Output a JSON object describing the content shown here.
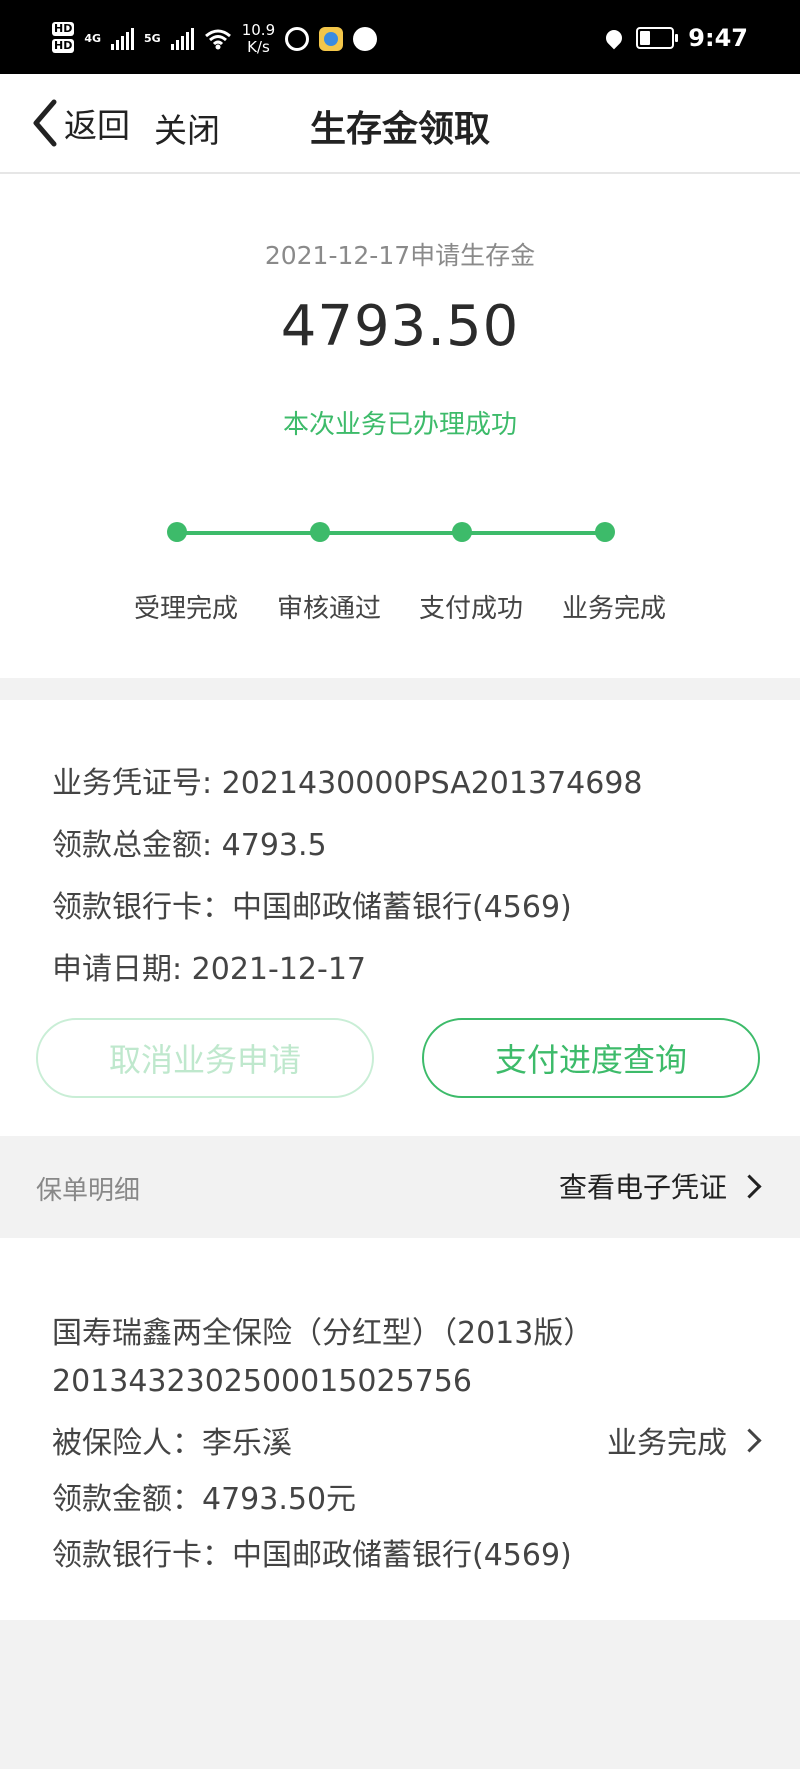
{
  "status_bar": {
    "hd1": "HD",
    "hd2": "HD",
    "net1": "4G",
    "net2": "5G",
    "speed_value": "10.9",
    "speed_unit": "K/s",
    "time": "9:47"
  },
  "nav": {
    "back_label": "返回",
    "close_label": "关闭",
    "title": "生存金领取"
  },
  "summary": {
    "apply_line": "2021-12-17申请生存金",
    "amount": "4793.50",
    "status": "本次业务已办理成功",
    "steps": [
      "受理完成",
      "审核通过",
      "支付成功",
      "业务完成"
    ]
  },
  "details": {
    "voucher": "业务凭证号: 2021430000PSA201374698",
    "total_amount": "领款总金额: 4793.5",
    "bank_card": "领款银行卡：中国邮政储蓄银行(4569)",
    "apply_date": "申请日期: 2021-12-17",
    "cancel_button": "取消业务申请",
    "query_button": "支付进度查询"
  },
  "section": {
    "label": "保单明细",
    "link": "查看电子凭证"
  },
  "policy": {
    "name": "国寿瑞鑫两全保险（分红型）（2013版）",
    "number": "2013432302500015025756",
    "insured": "被保险人：李乐溪",
    "status": "业务完成",
    "amount": "领款金额：4793.50元",
    "bank_card": "领款银行卡：中国邮政储蓄银行(4569)"
  },
  "colors": {
    "accent": "#3dbb6a",
    "accent_light": "#c9eed6",
    "background": "#f2f2f2"
  }
}
